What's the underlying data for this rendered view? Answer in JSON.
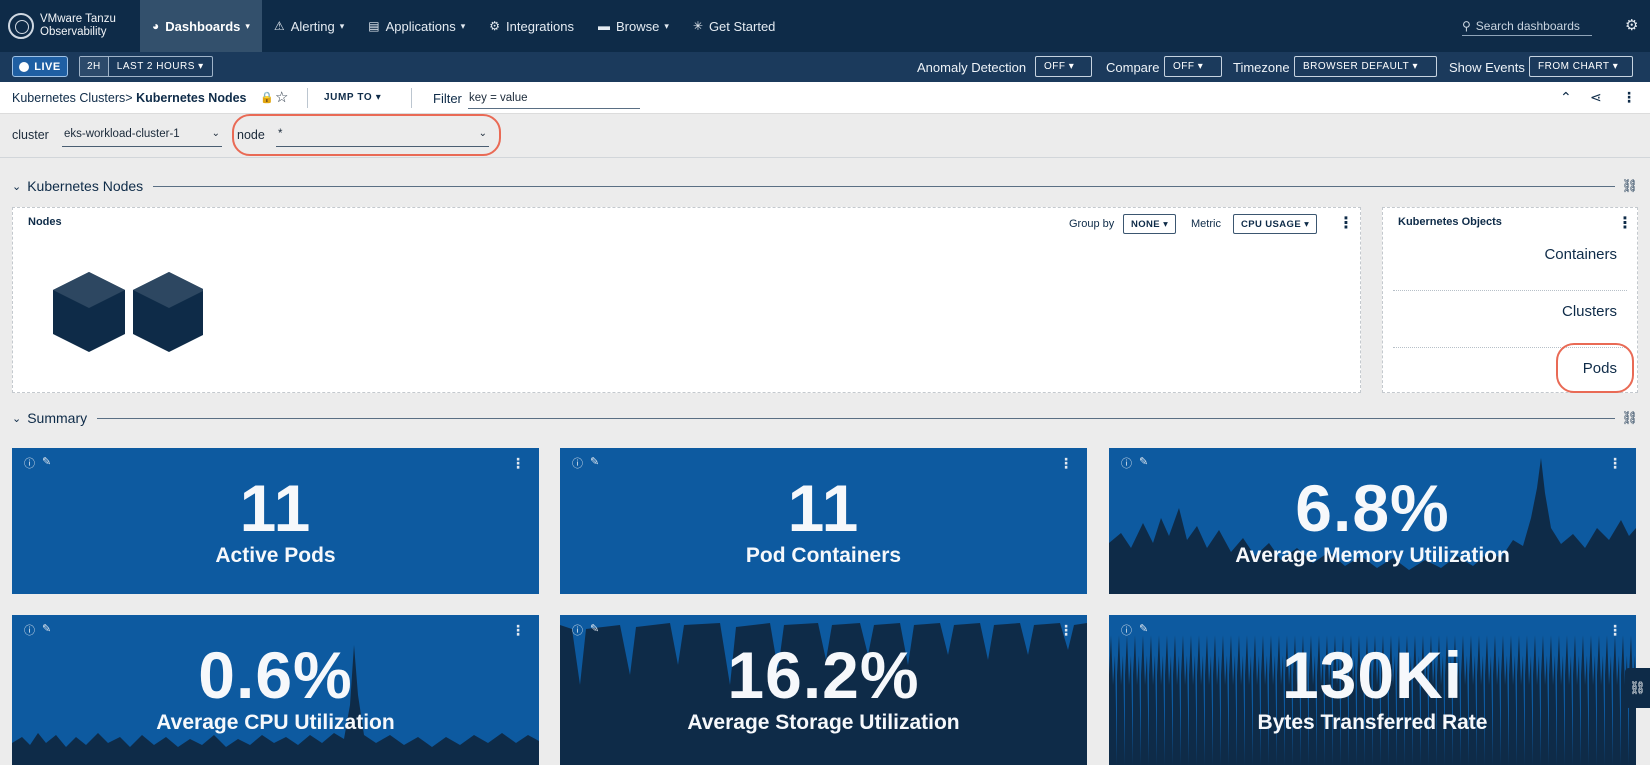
{
  "brand": {
    "line1": "VMware Tanzu",
    "line2": "Observability"
  },
  "nav": {
    "dashboards": "Dashboards",
    "alerting": "Alerting",
    "applications": "Applications",
    "integrations": "Integrations",
    "browse": "Browse",
    "get_started": "Get Started",
    "search_placeholder": "Search dashboards"
  },
  "timebar": {
    "live": "LIVE",
    "range_short": "2H",
    "range_long": "LAST 2 HOURS",
    "anomaly_label": "Anomaly Detection",
    "anomaly_value": "OFF",
    "compare_label": "Compare",
    "compare_value": "OFF",
    "timezone_label": "Timezone",
    "timezone_value": "BROWSER DEFAULT",
    "events_label": "Show Events",
    "events_value": "FROM CHART"
  },
  "breadcrumb": {
    "parent": "Kubernetes Clusters",
    "separator": ">",
    "current": "Kubernetes Nodes",
    "jump_to": "JUMP TO",
    "filter_label": "Filter",
    "filter_value": "key = value"
  },
  "variables": {
    "cluster_label": "cluster",
    "cluster_value": "eks-workload-cluster-1",
    "node_label": "node",
    "node_value": "*"
  },
  "sections": {
    "nodes_title": "Kubernetes Nodes",
    "summary_title": "Summary"
  },
  "nodes_panel": {
    "title": "Nodes",
    "group_by_label": "Group by",
    "group_by_value": "NONE",
    "metric_label": "Metric",
    "metric_value": "CPU USAGE"
  },
  "objects_panel": {
    "title": "Kubernetes Objects",
    "items": [
      "Containers",
      "Clusters",
      "Pods"
    ]
  },
  "tiles": [
    {
      "value": "11",
      "label": "Active Pods"
    },
    {
      "value": "11",
      "label": "Pod Containers"
    },
    {
      "value": "6.8%",
      "label": "Average Memory Utilization"
    },
    {
      "value": "0.6%",
      "label": "Average CPU Utilization"
    },
    {
      "value": "16.2%",
      "label": "Average Storage Utilization"
    },
    {
      "value": "130Ki",
      "label": "Bytes Transferred Rate"
    }
  ],
  "colors": {
    "nav_bg": "#0e2b48",
    "tile_blue": "#0d5aa0",
    "tile_dark": "#0e2b48",
    "highlight": "#e96a55"
  }
}
